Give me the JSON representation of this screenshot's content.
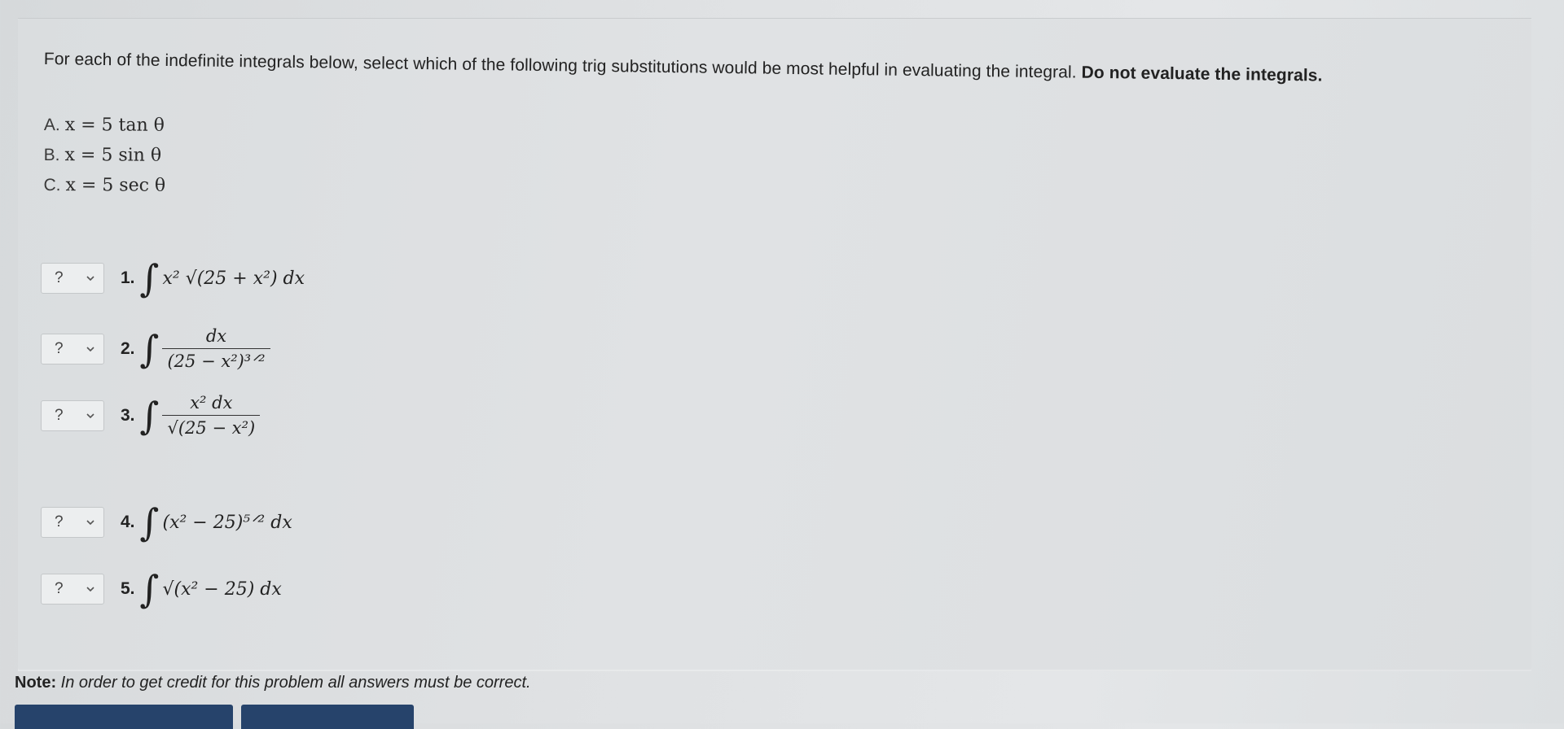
{
  "question": {
    "prompt_text": "For each of the indefinite integrals below, select which of the following trig substitutions would be most helpful in evaluating the integral.",
    "prompt_bold": "Do not evaluate the integrals."
  },
  "choices": [
    {
      "letter": "A.",
      "math": "x = 5 tan θ"
    },
    {
      "letter": "B.",
      "math": "x = 5 sin θ"
    },
    {
      "letter": "C.",
      "math": "x = 5 sec θ"
    }
  ],
  "items": [
    {
      "number": "1.",
      "selected": "?",
      "integrand": "x² √(25 + x²) dx"
    },
    {
      "number": "2.",
      "selected": "?",
      "numerator": "dx",
      "denominator": "(25 − x²)³ᐟ²"
    },
    {
      "number": "3.",
      "selected": "?",
      "numerator": "x² dx",
      "denominator": "√(25 − x²)"
    },
    {
      "number": "4.",
      "selected": "?",
      "integrand": "(x² − 25)⁵ᐟ² dx"
    },
    {
      "number": "5.",
      "selected": "?",
      "integrand": "√(x² − 25) dx"
    }
  ],
  "integral_symbol": "∫",
  "note": {
    "label": "Note:",
    "text": "In order to get credit for this problem all answers must be correct."
  },
  "colors": {
    "footer_button": "#26436b"
  },
  "icons": {
    "dropdown": "chevron-down-icon"
  }
}
